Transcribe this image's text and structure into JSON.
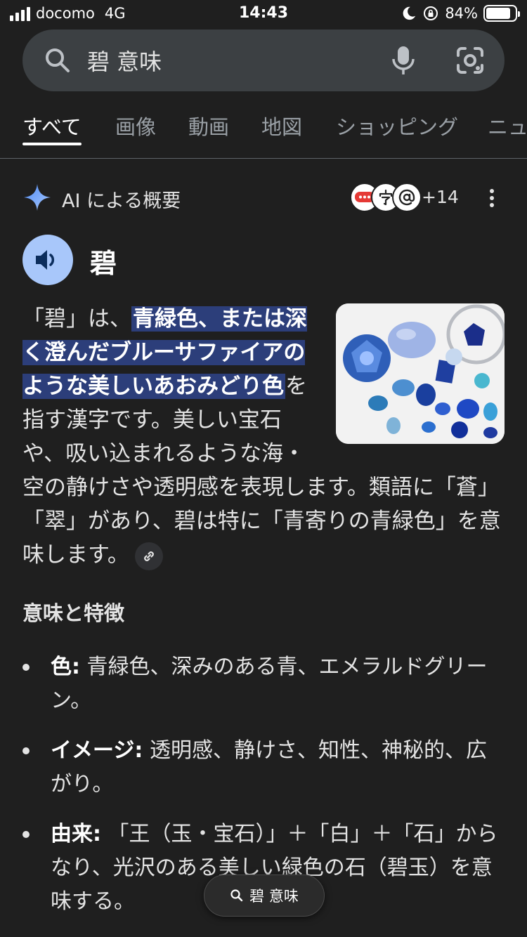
{
  "status_bar": {
    "carrier": "docomo",
    "network": "4G",
    "time": "14:43",
    "battery": "84%",
    "battery_level": 0.84
  },
  "search": {
    "query": "碧 意味"
  },
  "tabs": [
    {
      "label": "すべて",
      "active": true
    },
    {
      "label": "画像"
    },
    {
      "label": "動画"
    },
    {
      "label": "地図"
    },
    {
      "label": "ショッピング"
    },
    {
      "label": "ニュ"
    }
  ],
  "ai_overview": {
    "title": "AI による概要",
    "sources_more": "+14",
    "source_icons": [
      "chat-bubble-icon",
      "kanji-ji-icon",
      "at-sign-icon"
    ]
  },
  "entry": {
    "word": "碧",
    "desc_before": "「碧」は、",
    "desc_highlight": "青緑色、または深く澄んだブルーサファイアのような美しいあおみどり色",
    "desc_after": "を指す漢字です。美しい宝石や、吸い込まれるような海・空の静けさや透明感を表現します。類語に「蒼」「翠」があり、碧は特に「青寄りの青緑色」を意味します。"
  },
  "section": {
    "title": "意味と特徴",
    "items": [
      {
        "label": "色:",
        "text": "青緑色、深みのある青、エメラルドグリーン。"
      },
      {
        "label": "イメージ:",
        "text": "透明感、静けさ、知性、神秘的、広がり。"
      },
      {
        "label": "由来:",
        "text": "「王（玉・宝石）」＋「白」＋「石」からなり、光沢のある美しい緑色の石（碧玉）を意味する。"
      }
    ]
  },
  "floating_chip": {
    "label": "碧 意味"
  },
  "colors": {
    "background": "#1f1f1f",
    "search_bg": "#3c4043",
    "highlight": "#2c3e7a",
    "speaker": "#a8c7fa"
  }
}
